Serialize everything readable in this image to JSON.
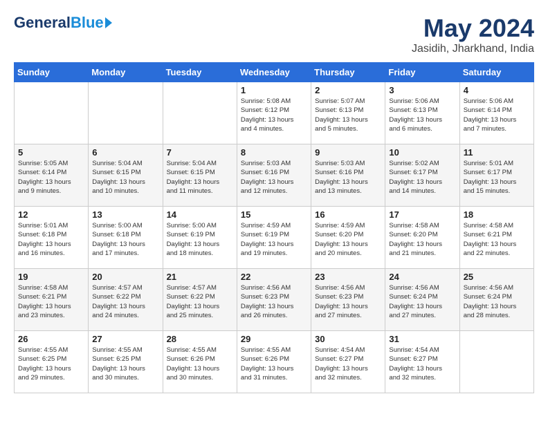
{
  "header": {
    "logo_general": "General",
    "logo_blue": "Blue",
    "month_year": "May 2024",
    "location": "Jasidih, Jharkhand, India"
  },
  "days_of_week": [
    "Sunday",
    "Monday",
    "Tuesday",
    "Wednesday",
    "Thursday",
    "Friday",
    "Saturday"
  ],
  "weeks": [
    [
      {
        "day": "",
        "content": ""
      },
      {
        "day": "",
        "content": ""
      },
      {
        "day": "",
        "content": ""
      },
      {
        "day": "1",
        "content": "Sunrise: 5:08 AM\nSunset: 6:12 PM\nDaylight: 13 hours\nand 4 minutes."
      },
      {
        "day": "2",
        "content": "Sunrise: 5:07 AM\nSunset: 6:13 PM\nDaylight: 13 hours\nand 5 minutes."
      },
      {
        "day": "3",
        "content": "Sunrise: 5:06 AM\nSunset: 6:13 PM\nDaylight: 13 hours\nand 6 minutes."
      },
      {
        "day": "4",
        "content": "Sunrise: 5:06 AM\nSunset: 6:14 PM\nDaylight: 13 hours\nand 7 minutes."
      }
    ],
    [
      {
        "day": "5",
        "content": "Sunrise: 5:05 AM\nSunset: 6:14 PM\nDaylight: 13 hours\nand 9 minutes."
      },
      {
        "day": "6",
        "content": "Sunrise: 5:04 AM\nSunset: 6:15 PM\nDaylight: 13 hours\nand 10 minutes."
      },
      {
        "day": "7",
        "content": "Sunrise: 5:04 AM\nSunset: 6:15 PM\nDaylight: 13 hours\nand 11 minutes."
      },
      {
        "day": "8",
        "content": "Sunrise: 5:03 AM\nSunset: 6:16 PM\nDaylight: 13 hours\nand 12 minutes."
      },
      {
        "day": "9",
        "content": "Sunrise: 5:03 AM\nSunset: 6:16 PM\nDaylight: 13 hours\nand 13 minutes."
      },
      {
        "day": "10",
        "content": "Sunrise: 5:02 AM\nSunset: 6:17 PM\nDaylight: 13 hours\nand 14 minutes."
      },
      {
        "day": "11",
        "content": "Sunrise: 5:01 AM\nSunset: 6:17 PM\nDaylight: 13 hours\nand 15 minutes."
      }
    ],
    [
      {
        "day": "12",
        "content": "Sunrise: 5:01 AM\nSunset: 6:18 PM\nDaylight: 13 hours\nand 16 minutes."
      },
      {
        "day": "13",
        "content": "Sunrise: 5:00 AM\nSunset: 6:18 PM\nDaylight: 13 hours\nand 17 minutes."
      },
      {
        "day": "14",
        "content": "Sunrise: 5:00 AM\nSunset: 6:19 PM\nDaylight: 13 hours\nand 18 minutes."
      },
      {
        "day": "15",
        "content": "Sunrise: 4:59 AM\nSunset: 6:19 PM\nDaylight: 13 hours\nand 19 minutes."
      },
      {
        "day": "16",
        "content": "Sunrise: 4:59 AM\nSunset: 6:20 PM\nDaylight: 13 hours\nand 20 minutes."
      },
      {
        "day": "17",
        "content": "Sunrise: 4:58 AM\nSunset: 6:20 PM\nDaylight: 13 hours\nand 21 minutes."
      },
      {
        "day": "18",
        "content": "Sunrise: 4:58 AM\nSunset: 6:21 PM\nDaylight: 13 hours\nand 22 minutes."
      }
    ],
    [
      {
        "day": "19",
        "content": "Sunrise: 4:58 AM\nSunset: 6:21 PM\nDaylight: 13 hours\nand 23 minutes."
      },
      {
        "day": "20",
        "content": "Sunrise: 4:57 AM\nSunset: 6:22 PM\nDaylight: 13 hours\nand 24 minutes."
      },
      {
        "day": "21",
        "content": "Sunrise: 4:57 AM\nSunset: 6:22 PM\nDaylight: 13 hours\nand 25 minutes."
      },
      {
        "day": "22",
        "content": "Sunrise: 4:56 AM\nSunset: 6:23 PM\nDaylight: 13 hours\nand 26 minutes."
      },
      {
        "day": "23",
        "content": "Sunrise: 4:56 AM\nSunset: 6:23 PM\nDaylight: 13 hours\nand 27 minutes."
      },
      {
        "day": "24",
        "content": "Sunrise: 4:56 AM\nSunset: 6:24 PM\nDaylight: 13 hours\nand 27 minutes."
      },
      {
        "day": "25",
        "content": "Sunrise: 4:56 AM\nSunset: 6:24 PM\nDaylight: 13 hours\nand 28 minutes."
      }
    ],
    [
      {
        "day": "26",
        "content": "Sunrise: 4:55 AM\nSunset: 6:25 PM\nDaylight: 13 hours\nand 29 minutes."
      },
      {
        "day": "27",
        "content": "Sunrise: 4:55 AM\nSunset: 6:25 PM\nDaylight: 13 hours\nand 30 minutes."
      },
      {
        "day": "28",
        "content": "Sunrise: 4:55 AM\nSunset: 6:26 PM\nDaylight: 13 hours\nand 30 minutes."
      },
      {
        "day": "29",
        "content": "Sunrise: 4:55 AM\nSunset: 6:26 PM\nDaylight: 13 hours\nand 31 minutes."
      },
      {
        "day": "30",
        "content": "Sunrise: 4:54 AM\nSunset: 6:27 PM\nDaylight: 13 hours\nand 32 minutes."
      },
      {
        "day": "31",
        "content": "Sunrise: 4:54 AM\nSunset: 6:27 PM\nDaylight: 13 hours\nand 32 minutes."
      },
      {
        "day": "",
        "content": ""
      }
    ]
  ]
}
